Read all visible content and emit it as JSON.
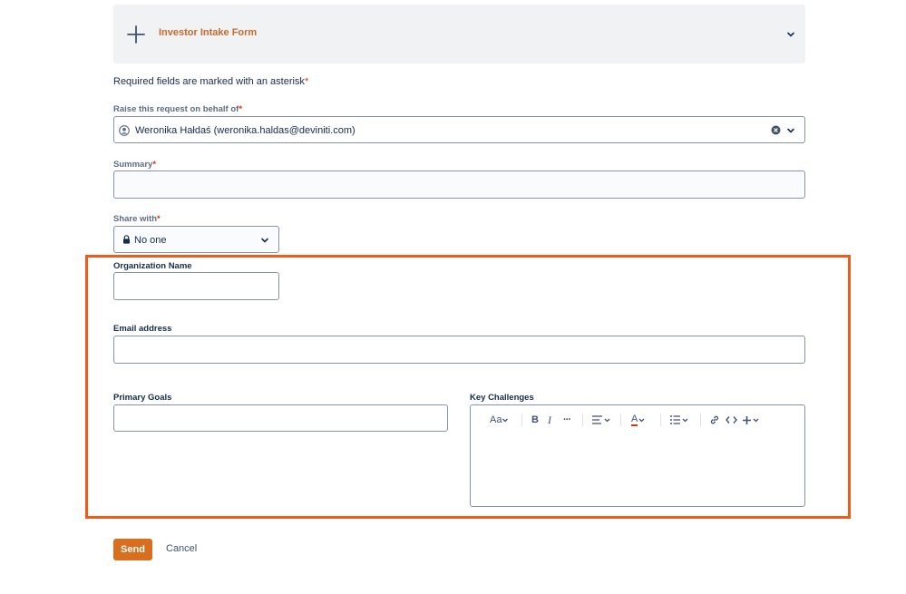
{
  "request_type": {
    "name": "Investor Intake Form",
    "plus_icon": "plus-icon",
    "expand_icon": "chevron-down-icon"
  },
  "required_note": {
    "text": "Required fields are marked with an asterisk",
    "asterisk": "*"
  },
  "fields": {
    "on_behalf": {
      "label": "Raise this request on behalf of",
      "asterisk": "*",
      "value": "Weronika Hałdaś (weronika.haldas@deviniti.com)",
      "avatar_icon": "user-avatar-icon",
      "clear_icon": "clear-circle-icon",
      "dropdown_icon": "chevron-down-icon"
    },
    "summary": {
      "label": "Summary",
      "asterisk": "*",
      "value": ""
    },
    "share_with": {
      "label": "Share with",
      "asterisk": "*",
      "value": "No one",
      "lock_icon": "lock-icon",
      "dropdown_icon": "chevron-down-icon"
    },
    "organization_name": {
      "label": "Organization Name",
      "value": ""
    },
    "email_address": {
      "label": "Email address",
      "value": ""
    },
    "primary_goals": {
      "label": "Primary Goals",
      "value": ""
    },
    "key_challenges": {
      "label": "Key Challenges",
      "value": "",
      "toolbar": {
        "text_style": "Aa",
        "bold": "B",
        "italic": "I",
        "more": "···",
        "text_color": "A"
      }
    }
  },
  "actions": {
    "send": "Send",
    "cancel": "Cancel"
  },
  "colors": {
    "accent_orange": "#d96f1e",
    "highlight_border": "#f25a1a",
    "required_red": "#de350b",
    "type_name": "#c9692b"
  }
}
